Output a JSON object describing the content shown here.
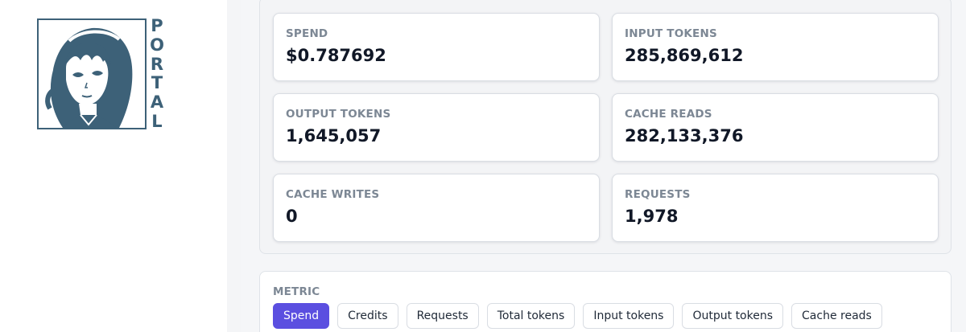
{
  "brand": {
    "logo_letters": [
      "P",
      "O",
      "R",
      "T",
      "A",
      "L"
    ],
    "color": "#3d6178"
  },
  "stats": [
    {
      "label": "SPEND",
      "value": "$0.787692"
    },
    {
      "label": "INPUT TOKENS",
      "value": "285,869,612"
    },
    {
      "label": "OUTPUT TOKENS",
      "value": "1,645,057"
    },
    {
      "label": "CACHE READS",
      "value": "282,133,376"
    },
    {
      "label": "CACHE WRITES",
      "value": "0"
    },
    {
      "label": "REQUESTS",
      "value": "1,978"
    }
  ],
  "metric": {
    "label": "METRIC",
    "selected": "Spend",
    "options": [
      "Spend",
      "Credits",
      "Requests",
      "Total tokens",
      "Input tokens",
      "Output tokens",
      "Cache reads"
    ],
    "accent_color": "#5b4fe0"
  }
}
